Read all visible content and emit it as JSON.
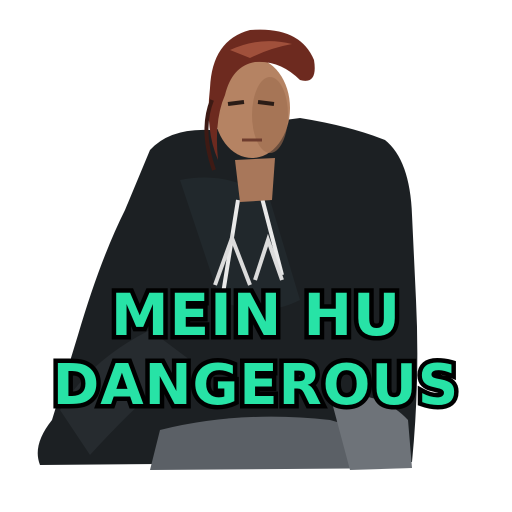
{
  "sticker": {
    "caption_line_1": "MEIN HU",
    "caption_line_2": "DANGEROUS"
  },
  "colors": {
    "caption_fill": "#27E3A6",
    "caption_outline": "#000000",
    "background": "#FFFFFF"
  }
}
